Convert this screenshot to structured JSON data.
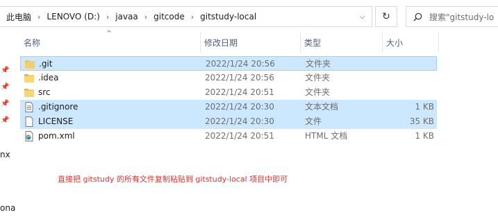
{
  "address": {
    "crumbs": [
      "此电脑",
      "LENOVO (D:)",
      "javaa",
      "gitcode",
      "gitstudy-local"
    ],
    "dropdown_glyph": "⌵",
    "refresh_glyph": "↻"
  },
  "search": {
    "placeholder": "搜索\"gitstudy-lo"
  },
  "side": {
    "label1": "nx",
    "label2": "ona"
  },
  "columns": {
    "name": "名称",
    "date": "修改日期",
    "type": "类型",
    "size": "大小"
  },
  "files": [
    {
      "name": ".git",
      "date": "2022/1/24 20:56",
      "type": "文件夹",
      "size": "",
      "icon": "folder-icon"
    },
    {
      "name": ".idea",
      "date": "2022/1/24 20:56",
      "type": "文件夹",
      "size": "",
      "icon": "folder-icon"
    },
    {
      "name": "src",
      "date": "2022/1/24 20:51",
      "type": "文件夹",
      "size": "",
      "icon": "folder-icon"
    },
    {
      "name": ".gitignore",
      "date": "2022/1/24 20:30",
      "type": "文本文档",
      "size": "1 KB",
      "icon": "text-file-icon"
    },
    {
      "name": "LICENSE",
      "date": "2022/1/24 20:30",
      "type": "文件",
      "size": "35 KB",
      "icon": "blank-file-icon"
    },
    {
      "name": "pom.xml",
      "date": "2022/1/24 20:51",
      "type": "HTML 文档",
      "size": "1 KB",
      "icon": "browser-file-icon"
    }
  ],
  "note": "直接把 gitstudy 的所有文件复制粘贴到 gitstudy-local 项目中即可",
  "colors": {
    "selection": "#cce8ff",
    "note": "#e0322f",
    "folder": "#f8d775"
  }
}
